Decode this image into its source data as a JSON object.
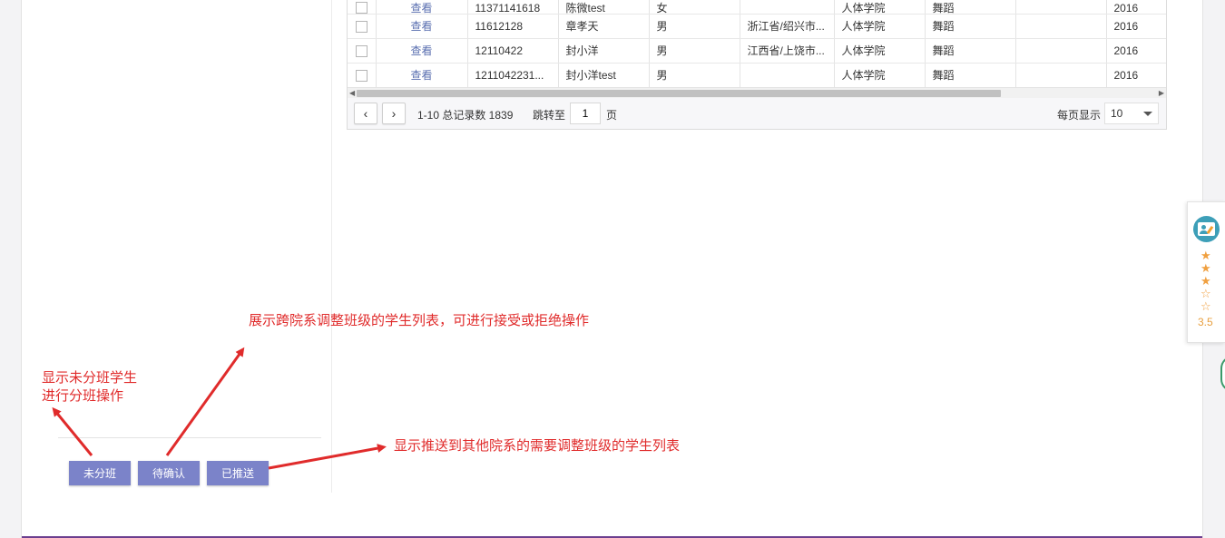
{
  "table": {
    "rows": [
      {
        "view": "查看",
        "id": "11371141618",
        "name": "陈微test",
        "gender": "女",
        "origin": "",
        "college": "人体学院",
        "major": "舞蹈",
        "extra": "",
        "year": "2016"
      },
      {
        "view": "查看",
        "id": "11612128",
        "name": "章孝天",
        "gender": "男",
        "origin": "浙江省/绍兴市...",
        "college": "人体学院",
        "major": "舞蹈",
        "extra": "",
        "year": "2016"
      },
      {
        "view": "查看",
        "id": "12110422",
        "name": "封小洋",
        "gender": "男",
        "origin": "江西省/上饶市...",
        "college": "人体学院",
        "major": "舞蹈",
        "extra": "",
        "year": "2016"
      },
      {
        "view": "查看",
        "id": "1211042231...",
        "name": "封小洋test",
        "gender": "男",
        "origin": "",
        "college": "人体学院",
        "major": "舞蹈",
        "extra": "",
        "year": "2016"
      }
    ]
  },
  "pager": {
    "prev_icon": "chevron-left-icon",
    "next_icon": "chevron-right-icon",
    "range_total": "1-10 总记录数 1839",
    "jump_label": "跳转至",
    "page_value": "1",
    "page_unit": "页",
    "per_page_label": "每页显示",
    "per_page_value": "10"
  },
  "left_buttons": {
    "unassigned": "未分班",
    "pending": "待确认",
    "pushed": "已推送"
  },
  "annotations": {
    "note_unassigned_line1": "显示未分班学生",
    "note_unassigned_line2": "进行分班操作",
    "note_pending": "展示跨院系调整班级的学生列表，可进行接受或拒绝操作",
    "note_pushed": "显示推送到其他院系的需要调整班级的学生列表"
  },
  "rating_widget": {
    "icon": "review-icon",
    "stars": [
      "★",
      "★",
      "★",
      "☆",
      "☆"
    ],
    "score": "3.5"
  },
  "colors": {
    "button": "#7b83c9",
    "link": "#5a6fb0",
    "annotation": "#e02b2b",
    "accent_line": "#6b3f8f",
    "star": "#f0a040"
  }
}
